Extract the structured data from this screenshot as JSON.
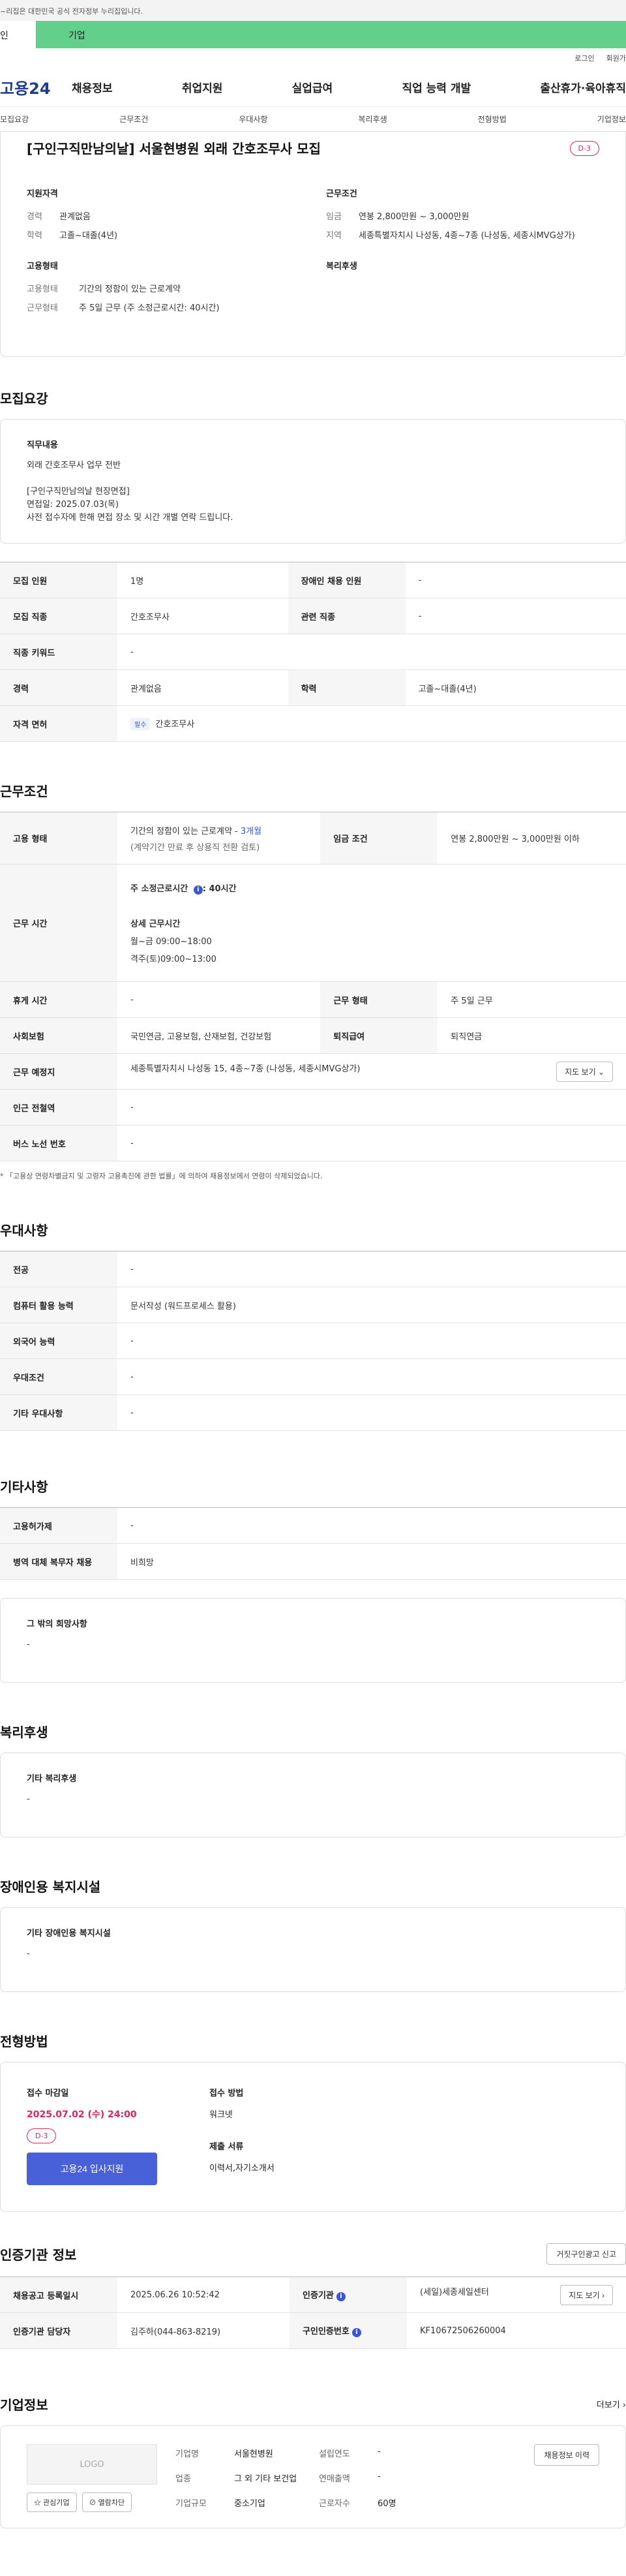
{
  "banner": {
    "text": "~리집은 대한민국 공식 전자정부 누리집입니다."
  },
  "top_tabs": {
    "tab1": "인",
    "tab2": "기업"
  },
  "util": {
    "login": "로그인",
    "join": "회원가"
  },
  "gnb": {
    "logo": "고용24",
    "menu": [
      "채용정보",
      "취업지원",
      "실업급여",
      "직업 능력 개발",
      "출산휴가·육아휴직"
    ]
  },
  "anchor": [
    "모집요강",
    "근무조건",
    "우대사항",
    "복리후생",
    "전형방법",
    "기업정보"
  ],
  "summary": {
    "title": "[구인구직만남의날] 서울현병원 외래 간호조무사 모집",
    "dday": "D-3",
    "qual_title": "지원자격",
    "career_k": "경력",
    "career_v": "관계없음",
    "edu_k": "학력",
    "edu_v": "고졸~대졸(4년)",
    "work_title": "근무조건",
    "wage_k": "임금",
    "wage_v": "연봉 2,800만원 ~ 3,000만원",
    "area_k": "지역",
    "area_v": "세종특별자치시 나성동, 4종~7종 (나성동, 세종시MVG상가)",
    "emp_title": "고용형태",
    "emp_k1": "고용형태",
    "emp_v1": "기간의 정함이 있는 근로계약",
    "emp_k2": "근무형태",
    "emp_v2": "주 5일 근무 (주 소정근로시간: 40시간)",
    "welfare_title": "복리후생"
  },
  "recruit": {
    "title": "모집요강",
    "job_title": "직무내용",
    "job_lines": [
      "외래 간호조무사 업무 전반",
      "",
      "[구인구직만남의날 현장면접]",
      "면접일: 2025.07.03(목)",
      "사전 접수자에 한해 면접 장소 및 시간 개별 연락 드립니다."
    ],
    "rows": [
      [
        "모집 인원",
        "1명",
        "장애인 채용 인원",
        "-"
      ],
      [
        "모집 직종",
        "간호조무사",
        "관련 직종",
        "-"
      ],
      [
        "직종 키워드",
        "-"
      ],
      [
        "경력",
        "관계없음",
        "학력",
        "고졸~대졸(4년)"
      ],
      [
        "자격 면허",
        "간호조무사"
      ]
    ],
    "license_badge": "필수"
  },
  "work": {
    "title": "근무조건",
    "emp_h": "고용 형태",
    "emp_v1": "기간의 정함이 있는 근로계약 - ",
    "emp_v1b": "3개월",
    "emp_v2": "(계약기간 만료 후 상용직 전환 검토)",
    "wage_h": "임금 조건",
    "wage_v": "연봉 2,800만원 ~ 3,000만원 이하",
    "time_h": "근무 시간",
    "time_v1": "주 소정근로시간",
    "time_v1b": ": 40시간",
    "time_v2": "상세 근무시간",
    "time_v3": "월~금 09:00~18:00",
    "time_v4": "격주(토)09:00~13:00",
    "rest_h": "휴게 시간",
    "rest_v": "-",
    "type_h": "근무 형태",
    "type_v": "주 5일 근무",
    "ins_h": "사회보험",
    "ins_v": "국민연금, 고용보험, 산재보험, 건강보험",
    "ret_h": "퇴직급여",
    "ret_v": "퇴직연금",
    "place_h": "근무 예정지",
    "place_v": "세종특별자치시 나성동 15, 4종~7종 (나성동, 세종시MVG상가)",
    "map_btn": "지도 보기 ⌄",
    "station_h": "인근 전철역",
    "station_v": "-",
    "bus_h": "버스 노선 번호",
    "bus_v": "-",
    "note": "* 「고용상 연령차별금지 및 고령자 고용촉진에 관한 법률」에 의하여 채용정보에서 연령이 삭제되었습니다."
  },
  "pref": {
    "title": "우대사항",
    "rows": [
      [
        "전공",
        "-"
      ],
      [
        "컴퓨터 활용 능력",
        "문서작성 (워드프로세스 활용)"
      ],
      [
        "외국어 능력",
        "-"
      ],
      [
        "우대조건",
        "-"
      ],
      [
        "기타 우대사항",
        "-"
      ]
    ]
  },
  "etc": {
    "title": "기타사항",
    "rows": [
      [
        "고용허가제",
        "-"
      ],
      [
        "병역 대체 복무자 채용",
        "비희망"
      ]
    ],
    "hope_title": "그 밖의 희망사항",
    "hope_v": "-"
  },
  "welfare": {
    "title": "복리후생",
    "box_title": "기타 복리후생",
    "box_v": "-"
  },
  "disabled": {
    "title": "장애인용 복지시설",
    "box_title": "기타 장애인용 복지시설",
    "box_v": "-"
  },
  "apply": {
    "title": "전형방법",
    "deadline_title": "접수 마감일",
    "deadline": "2025.07.02 (수) 24:00",
    "dday": "D-3",
    "apply_btn": "고용24 입사지원",
    "method_title": "접수 방법",
    "method_v": "워크넷",
    "docs_title": "제출 서류",
    "docs_v": "이력서,자기소개서"
  },
  "cert": {
    "title": "인증기관 정보",
    "report_btn": "거짓구인광고 신고",
    "rows": [
      [
        "채용공고 등록일시",
        "2025.06.26 10:52:42",
        "인증기관",
        "(세일)세종세일센터"
      ],
      [
        "인증기관 담당자",
        "김주하(044-863-8219)",
        "구인인증번호",
        "KF10672506260004"
      ]
    ],
    "map_btn": "지도 보기 ›",
    "info_icon": "i"
  },
  "company": {
    "title": "기업정보",
    "more": "더보기 ›",
    "logo_text": "LOGO",
    "fav_btn": "☆ 관심기업",
    "block_btn": "⊘ 열람차단",
    "history_btn": "채용정보 이력",
    "rows": [
      [
        "기업명",
        "서울현병원",
        "설립연도",
        "-"
      ],
      [
        "업종",
        "그 외 기타 보건업",
        "연매출액",
        "-"
      ],
      [
        "기업규모",
        "중소기업",
        "근로자수",
        "60명"
      ]
    ]
  }
}
